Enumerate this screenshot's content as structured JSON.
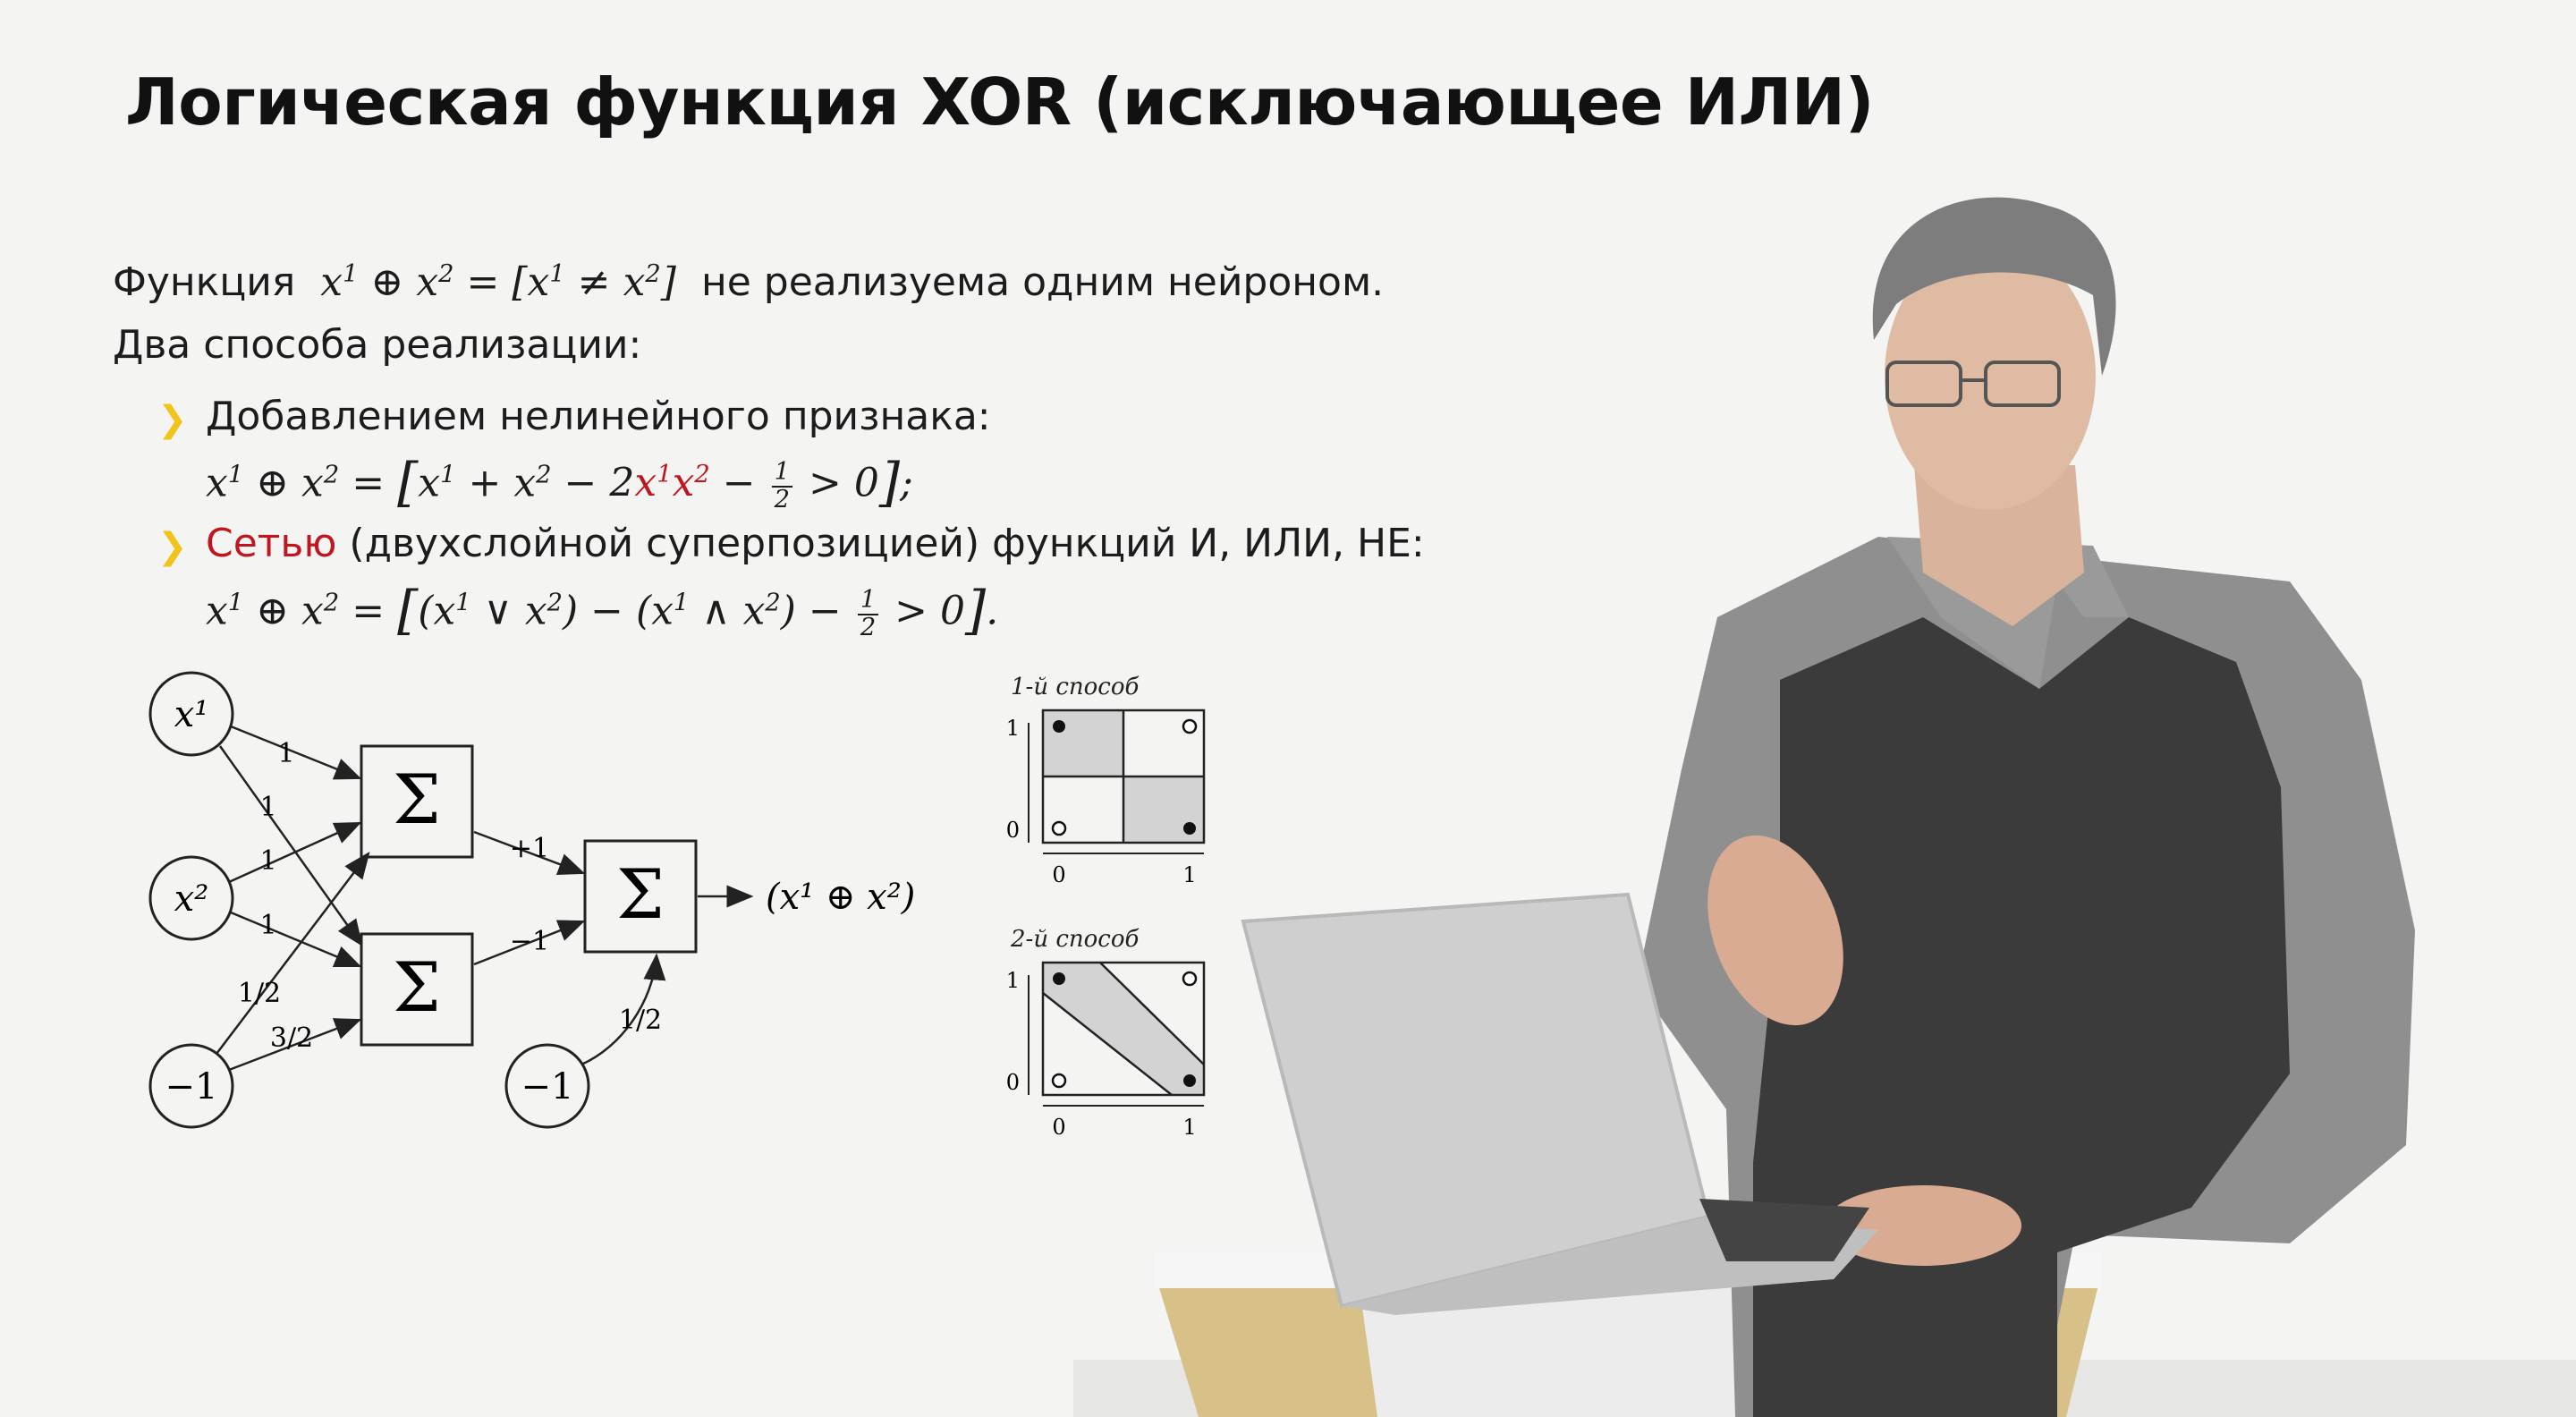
{
  "slide": {
    "title": "Логическая функция XOR (исключающее ИЛИ)",
    "intro": {
      "prefix": "Функция",
      "suffix": "не реализуема одним нейроном."
    },
    "subheading": "Два способа реализации:",
    "bullet1": {
      "text": "Добавлением нелинейного признака:"
    },
    "bullet2": {
      "highlight": "Сетью",
      "rest": "(двухслойной суперпозицией) функций И, ИЛИ, НЕ:"
    },
    "accent_red": "#c0161f",
    "bullet_color": "#f0c419"
  },
  "network": {
    "inputs": [
      "x¹",
      "x²",
      "−1"
    ],
    "bias2": "−1",
    "sum_symbol": "Σ",
    "output": "(x¹ ⊕ x²)",
    "weights": {
      "x1_to_s1": "1",
      "x1_to_s2": "1",
      "x2_to_s1": "1",
      "x2_to_s2": "1",
      "b_to_s1": "1/2",
      "b_to_s2": "3/2",
      "s1_to_out": "+1",
      "s2_to_out": "−1",
      "b2_to_out": "1/2"
    }
  },
  "plots": [
    {
      "title": "1-й способ",
      "xticks": [
        "0",
        "1"
      ],
      "yticks": [
        "0",
        "1"
      ]
    },
    {
      "title": "2-й способ",
      "xticks": [
        "0",
        "1"
      ],
      "yticks": [
        "0",
        "1"
      ]
    }
  ]
}
